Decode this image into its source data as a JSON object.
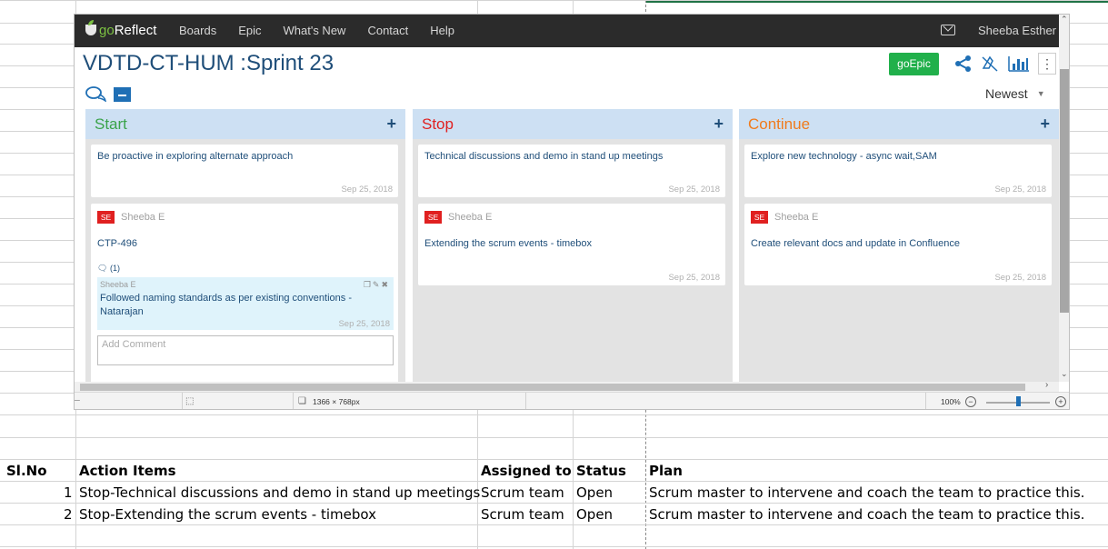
{
  "app": {
    "brand_prefix": "go",
    "brand_suffix": "Reflect",
    "nav_items": [
      "Boards",
      "Epic",
      "What's New",
      "Contact",
      "Help"
    ],
    "user_name": "Sheeba Esther"
  },
  "board": {
    "title": "VDTD-CT-HUM :Sprint 23",
    "goepic_label": "goEpic",
    "sort_label": "Newest",
    "columns": [
      {
        "name": "Start",
        "color": "#3aa34a",
        "cards": [
          {
            "text": "Be proactive in exploring alternate approach",
            "date": "Sep 25, 2018"
          },
          {
            "badge": "SE",
            "author": "Sheeba E",
            "text": "CTP-496",
            "comment_count": "(1)",
            "comment": {
              "author": "Sheeba E",
              "text": "Followed naming standards as per existing conventions - Natarajan",
              "date": "Sep 25, 2018"
            },
            "add_comment_placeholder": "Add Comment"
          }
        ]
      },
      {
        "name": "Stop",
        "color": "#e02020",
        "cards": [
          {
            "text": "Technical discussions and demo in stand up meetings",
            "date": "Sep 25, 2018"
          },
          {
            "badge": "SE",
            "author": "Sheeba E",
            "text": "Extending the scrum events - timebox",
            "date": "Sep 25, 2018"
          }
        ]
      },
      {
        "name": "Continue",
        "color": "#f07b1c",
        "cards": [
          {
            "text": "Explore new technology - async wait,SAM",
            "date": "Sep 25, 2018"
          },
          {
            "badge": "SE",
            "author": "Sheeba E",
            "text": "Create relevant docs and update in Confluence",
            "date": "Sep 25, 2018"
          }
        ]
      }
    ]
  },
  "viewer_status": {
    "resolution": "1366 × 768px",
    "zoom": "100%",
    "zoom_level": 0.5
  },
  "sheet": {
    "headers": [
      "Sl.No",
      "Action Items",
      "Assigned to",
      "Status",
      "Plan"
    ],
    "rows": [
      [
        "1",
        "Stop-Technical discussions and demo in stand up meetings",
        "Scrum team",
        "Open",
        "Scrum master to intervene and coach the team to practice this."
      ],
      [
        "2",
        "Stop-Extending the scrum events - timebox",
        "Scrum team",
        "Open",
        "Scrum master to intervene and coach the team to practice this."
      ]
    ]
  },
  "colors": {
    "excel_green": "#217346",
    "nav_dark": "#2b2b2b",
    "title_blue": "#1f4e79",
    "goepic_green": "#21b04b"
  }
}
